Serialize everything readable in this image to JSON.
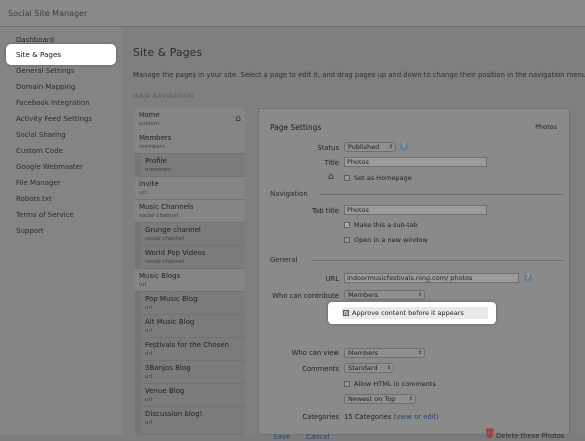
{
  "app": {
    "title": "Social Site Manager"
  },
  "sidebar": {
    "items": [
      {
        "label": "Dashboard"
      },
      {
        "label": "Site & Pages",
        "active": true
      },
      {
        "label": "General Settings"
      },
      {
        "label": "Domain Mapping"
      },
      {
        "label": "Facebook Integration"
      },
      {
        "label": "Activity Feed Settings"
      },
      {
        "label": "Social Sharing"
      },
      {
        "label": "Custom Code"
      },
      {
        "label": "Google Webmaster"
      },
      {
        "label": "File Manager"
      },
      {
        "label": "Robots.txt"
      },
      {
        "label": "Terms of Service"
      },
      {
        "label": "Support"
      }
    ]
  },
  "main": {
    "title": "Site & Pages",
    "description": "Manage the pages in your site. Select a page to edit it, and drag pages up and down to change their position in the navigation menu.",
    "nav_label": "MAIN NAVIGATION",
    "nav_items": [
      {
        "title": "Home",
        "sub": "custom",
        "child": false,
        "home_icon": "home-icon"
      },
      {
        "title": "Members",
        "sub": "members",
        "child": false
      },
      {
        "title": "Profile",
        "sub": "members",
        "child": true
      },
      {
        "title": "Invite",
        "sub": "url",
        "child": false
      },
      {
        "title": "Music Channels",
        "sub": "social channel",
        "child": false
      },
      {
        "title": "Grunge channel",
        "sub": "social channel",
        "child": true
      },
      {
        "title": "World Pop Videos",
        "sub": "social channel",
        "child": true
      },
      {
        "title": "Music Blogs",
        "sub": "url",
        "child": false
      },
      {
        "title": "Pop Music Blog",
        "sub": "url",
        "child": true
      },
      {
        "title": "Alt Music Blog",
        "sub": "url",
        "child": true
      },
      {
        "title": "Festivals for the Chosen",
        "sub": "url",
        "child": true
      },
      {
        "title": "3Banjos Blog",
        "sub": "url",
        "child": true
      },
      {
        "title": "Venue Blog",
        "sub": "url",
        "child": true
      },
      {
        "title": "Discussion blog!",
        "sub": "url",
        "child": true
      }
    ]
  },
  "panel": {
    "title": "Page Settings",
    "page_name": "Photos",
    "status_label": "Status",
    "status_value": "Published",
    "title_label": "Title",
    "title_value": "Photos",
    "homepage_label": "Set as Homepage",
    "navigation_section": "Navigation",
    "tab_title_label": "Tab title",
    "tab_title_value": "Photos",
    "subtab_label": "Make this a sub-tab",
    "new_window_label": "Open in a new window",
    "general_section": "General",
    "url_label": "URL",
    "url_value": "indoormusicfestivals.ning.com/ photos",
    "contribute_label": "Who can contribute",
    "contribute_value": "Members",
    "approve_label": "Approve content before it appears",
    "view_label": "Who can view",
    "view_value": "Members",
    "comments_label": "Comments",
    "comments_value": "Standard",
    "allow_html_label": "Allow HTML in comments",
    "sort_value": "Newest on Top",
    "categories_label": "Categories",
    "categories_value": "15 Categories",
    "view_or_edit": "(view or edit)",
    "save_label": "Save",
    "cancel_label": "Cancel",
    "delete_label": "Delete these Photos"
  }
}
